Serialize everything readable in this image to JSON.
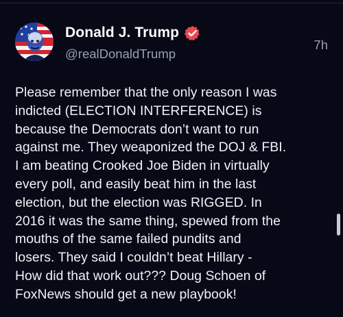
{
  "post": {
    "author": {
      "display_name": "Donald J. Trump",
      "handle": "@realDonaldTrump",
      "verified_icon": "verified-badge-icon",
      "avatar_icon": "avatar-image"
    },
    "timestamp": "7h",
    "body": "Please remember that the only reason I was\nindicted (ELECTION INTERFERENCE) is\nbecause the Democrats don’t want to run\nagainst me. They weaponized the DOJ & FBI.\nI am beating Crooked Joe Biden in virtually\nevery poll, and easily beat him in the last\nelection, but the election was RIGGED. In\n2016 it was the same thing, spewed from the\nmouths of the same failed pundits and\nlosers. They said I couldn’t beat Hillary -\nHow did that work out??? Doug Schoen of\nFoxNews should get a new playbook!"
  },
  "colors": {
    "background": "#070917",
    "text": "#f1f2f7",
    "secondary_text": "#9aa0b4",
    "verified_badge": "#e8484f"
  }
}
